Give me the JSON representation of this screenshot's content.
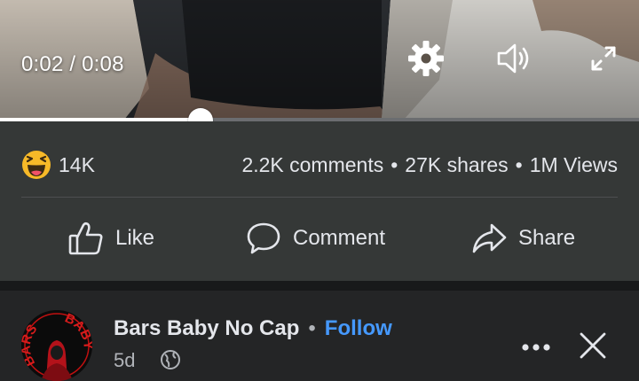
{
  "video": {
    "current_time": "0:02",
    "time_separator": " / ",
    "duration": "0:08",
    "progress_fraction": 0.314,
    "icons": [
      "gear-icon",
      "volume-icon",
      "fullscreen-icon"
    ]
  },
  "stats": {
    "reaction_icon": "haha-emoji-icon",
    "reaction_count": "14K",
    "comments": "2.2K comments",
    "shares": "27K shares",
    "views": "1M Views",
    "separator": "•"
  },
  "actions": {
    "like": "Like",
    "comment": "Comment",
    "share": "Share"
  },
  "next_post": {
    "author": "Bars Baby No Cap",
    "separator": "•",
    "follow": "Follow",
    "time_ago": "5d",
    "avatar_logo_text": "BARS BABY",
    "icons": [
      "globe-icon",
      "more-options-icon",
      "close-icon"
    ]
  },
  "colors": {
    "background": "#242526",
    "panel": "#353837",
    "text": "#e4e6eb",
    "muted": "#b0b3b8",
    "follow": "#4599ff",
    "reaction": "#f7b928"
  }
}
